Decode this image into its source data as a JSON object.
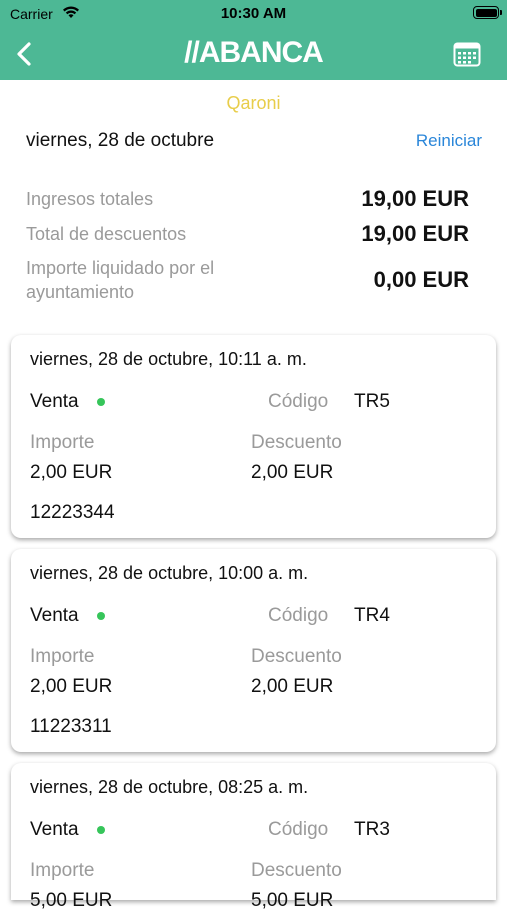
{
  "status_bar": {
    "carrier": "Carrier",
    "time": "10:30 AM"
  },
  "nav": {
    "logo": "//ABANCA",
    "back_icon": "chevron-left-icon",
    "calendar_icon": "calendar-icon"
  },
  "merchant_name": "Qaroni",
  "date_label": "viernes, 28 de octubre",
  "reset_label": "Reiniciar",
  "summary": {
    "total_income_label": "Ingresos totales",
    "total_income_value": "19,00 EUR",
    "total_discount_label": "Total de descuentos",
    "total_discount_value": "19,00 EUR",
    "settled_label": "Importe liquidado por el ayuntamiento",
    "settled_value": "0,00 EUR"
  },
  "labels": {
    "code": "Código",
    "amount": "Importe",
    "discount": "Descuento"
  },
  "colors": {
    "brand": "#4db895",
    "accent_yellow": "#e8cd4a",
    "link_blue": "#2a86d9",
    "status_green": "#36c55a"
  },
  "transactions": [
    {
      "datetime": "viernes, 28 de octubre, 10:11 a. m.",
      "type": "Venta",
      "code": "TR5",
      "amount": "2,00 EUR",
      "discount": "2,00 EUR",
      "reference": "12223344"
    },
    {
      "datetime": "viernes, 28 de octubre, 10:00 a. m.",
      "type": "Venta",
      "code": "TR4",
      "amount": "2,00 EUR",
      "discount": "2,00 EUR",
      "reference": "11223311"
    },
    {
      "datetime": "viernes, 28 de octubre, 08:25 a. m.",
      "type": "Venta",
      "code": "TR3",
      "amount": "5,00 EUR",
      "discount": "5,00 EUR",
      "reference": ""
    }
  ]
}
